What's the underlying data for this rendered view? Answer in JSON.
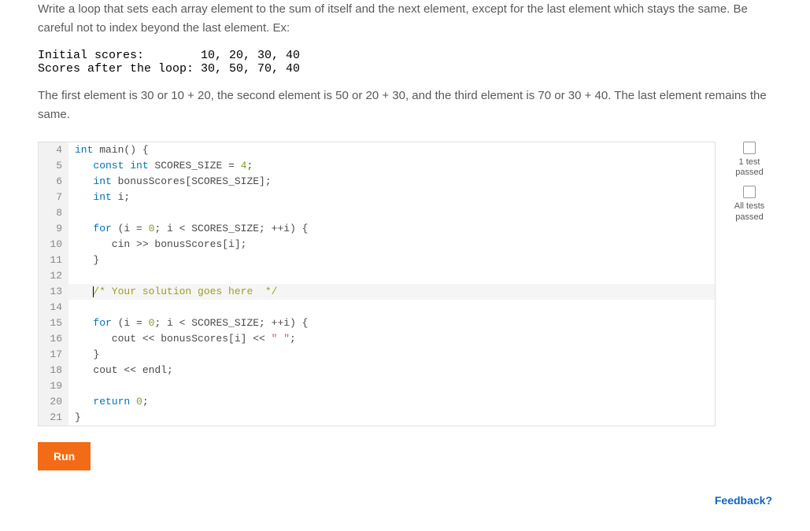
{
  "problem": {
    "para1": "Write a loop that sets each array element to the sum of itself and the next element, except for the last element which stays the same. Be careful not to index beyond the last element. Ex:",
    "example_line1": "Initial scores:        10, 20, 30, 40",
    "example_line2": "Scores after the loop: 30, 50, 70, 40",
    "para2": "The first element is 30 or 10 + 20, the second element is 50 or 20 + 30, and the third element is 70 or 30 + 40. The last element remains the same."
  },
  "status": {
    "one_test_label": "1 test\npassed",
    "all_tests_label": "All tests\npassed"
  },
  "run_label": "Run",
  "feedback_label": "Feedback?",
  "code_lines": [
    {
      "n": 4,
      "hl": false,
      "tokens": [
        [
          "type",
          "int"
        ],
        [
          "",
          " main() {"
        ]
      ]
    },
    {
      "n": 5,
      "hl": false,
      "tokens": [
        [
          "",
          "   "
        ],
        [
          "keyword",
          "const"
        ],
        [
          "",
          " "
        ],
        [
          "type",
          "int"
        ],
        [
          "",
          " SCORES_SIZE = "
        ],
        [
          "num",
          "4"
        ],
        [
          "",
          ";"
        ]
      ]
    },
    {
      "n": 6,
      "hl": false,
      "tokens": [
        [
          "",
          "   "
        ],
        [
          "type",
          "int"
        ],
        [
          "",
          " bonusScores[SCORES_SIZE];"
        ]
      ]
    },
    {
      "n": 7,
      "hl": false,
      "tokens": [
        [
          "",
          "   "
        ],
        [
          "type",
          "int"
        ],
        [
          "",
          " i;"
        ]
      ]
    },
    {
      "n": 8,
      "hl": false,
      "tokens": [
        [
          "",
          ""
        ]
      ]
    },
    {
      "n": 9,
      "hl": false,
      "tokens": [
        [
          "",
          "   "
        ],
        [
          "keyword",
          "for"
        ],
        [
          "",
          " (i = "
        ],
        [
          "num",
          "0"
        ],
        [
          "",
          "; i < SCORES_SIZE; ++i) {"
        ]
      ]
    },
    {
      "n": 10,
      "hl": false,
      "tokens": [
        [
          "",
          "      cin >> bonusScores[i];"
        ]
      ]
    },
    {
      "n": 11,
      "hl": false,
      "tokens": [
        [
          "",
          "   }"
        ]
      ]
    },
    {
      "n": 12,
      "hl": false,
      "tokens": [
        [
          "",
          ""
        ]
      ]
    },
    {
      "n": 13,
      "hl": true,
      "tokens": [
        [
          "",
          "   "
        ],
        [
          "comment",
          "/* Your solution goes here  */"
        ]
      ]
    },
    {
      "n": 14,
      "hl": false,
      "tokens": [
        [
          "",
          ""
        ]
      ]
    },
    {
      "n": 15,
      "hl": false,
      "tokens": [
        [
          "",
          "   "
        ],
        [
          "keyword",
          "for"
        ],
        [
          "",
          " (i = "
        ],
        [
          "num",
          "0"
        ],
        [
          "",
          "; i < SCORES_SIZE; ++i) {"
        ]
      ]
    },
    {
      "n": 16,
      "hl": false,
      "tokens": [
        [
          "",
          "      cout << bonusScores[i] << "
        ],
        [
          "str",
          "\" \""
        ],
        [
          "",
          ";"
        ]
      ]
    },
    {
      "n": 17,
      "hl": false,
      "tokens": [
        [
          "",
          "   }"
        ]
      ]
    },
    {
      "n": 18,
      "hl": false,
      "tokens": [
        [
          "",
          "   cout << endl;"
        ]
      ]
    },
    {
      "n": 19,
      "hl": false,
      "tokens": [
        [
          "",
          ""
        ]
      ]
    },
    {
      "n": 20,
      "hl": false,
      "tokens": [
        [
          "",
          "   "
        ],
        [
          "keyword",
          "return"
        ],
        [
          "",
          " "
        ],
        [
          "num",
          "0"
        ],
        [
          "",
          ";"
        ]
      ]
    },
    {
      "n": 21,
      "hl": false,
      "tokens": [
        [
          "",
          "}"
        ]
      ]
    }
  ]
}
